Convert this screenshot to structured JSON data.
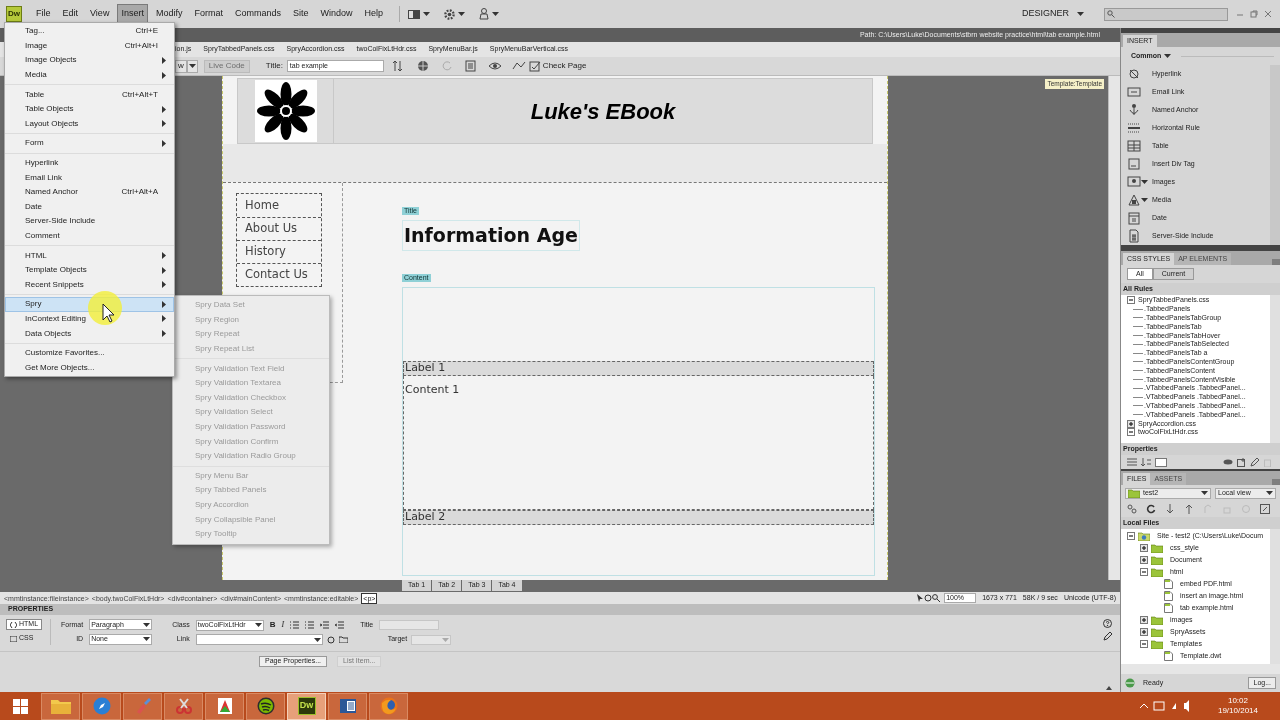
{
  "menubar": {
    "logo": "Dw",
    "menus": [
      {
        "label": "File",
        "selected": false
      },
      {
        "label": "Edit",
        "selected": false
      },
      {
        "label": "View",
        "selected": false
      },
      {
        "label": "Insert",
        "selected": true
      },
      {
        "label": "Modify",
        "selected": false
      },
      {
        "label": "Format",
        "selected": false
      },
      {
        "label": "Commands",
        "selected": false
      },
      {
        "label": "Site",
        "selected": false
      },
      {
        "label": "Window",
        "selected": false
      },
      {
        "label": "Help",
        "selected": false
      }
    ],
    "workspace": "DESIGNER"
  },
  "insert_menu": {
    "groups": [
      [
        {
          "label": "Tag...",
          "shortcut": "Ctrl+E",
          "submenu": false,
          "selected": false
        },
        {
          "label": "Image",
          "shortcut": "Ctrl+Alt+I",
          "submenu": false,
          "selected": false
        },
        {
          "label": "Image Objects",
          "submenu": true,
          "selected": false
        },
        {
          "label": "Media",
          "submenu": true,
          "selected": false
        }
      ],
      [
        {
          "label": "Table",
          "shortcut": "Ctrl+Alt+T",
          "submenu": false,
          "selected": false
        },
        {
          "label": "Table Objects",
          "submenu": true,
          "selected": false
        },
        {
          "label": "Layout Objects",
          "submenu": true,
          "selected": false
        }
      ],
      [
        {
          "label": "Form",
          "submenu": true,
          "selected": false
        }
      ],
      [
        {
          "label": "Hyperlink",
          "submenu": false,
          "selected": false
        },
        {
          "label": "Email Link",
          "submenu": false,
          "selected": false
        },
        {
          "label": "Named Anchor",
          "shortcut": "Ctrl+Alt+A",
          "submenu": false,
          "selected": false
        },
        {
          "label": "Date",
          "submenu": false,
          "selected": false
        },
        {
          "label": "Server-Side Include",
          "submenu": false,
          "selected": false
        },
        {
          "label": "Comment",
          "submenu": false,
          "selected": false
        }
      ],
      [
        {
          "label": "HTML",
          "submenu": true,
          "selected": false
        },
        {
          "label": "Template Objects",
          "submenu": true,
          "selected": false
        },
        {
          "label": "Recent Snippets",
          "submenu": true,
          "selected": false
        }
      ],
      [
        {
          "label": "Spry",
          "submenu": true,
          "selected": true
        },
        {
          "label": "InContext Editing",
          "submenu": true,
          "selected": false
        },
        {
          "label": "Data Objects",
          "submenu": true,
          "selected": false
        }
      ],
      [
        {
          "label": "Customize Favorites...",
          "submenu": false,
          "selected": false
        },
        {
          "label": "Get More Objects...",
          "submenu": false,
          "selected": false
        }
      ]
    ]
  },
  "spry_submenu": {
    "groups": [
      [
        "Spry Data Set",
        "Spry Region",
        "Spry Repeat",
        "Spry Repeat List"
      ],
      [
        "Spry Validation Text Field",
        "Spry Validation Textarea",
        "Spry Validation Checkbox",
        "Spry Validation Select",
        "Spry Validation Password",
        "Spry Validation Confirm",
        "Spry Validation Radio Group"
      ],
      [
        "Spry Menu Bar",
        "Spry Tabbed Panels",
        "Spry Accordion",
        "Spry Collapsible Panel",
        "Spry Tooltip"
      ]
    ]
  },
  "document": {
    "path": "Path:  C:\\Users\\Luke\\Documents\\stbrn website practice\\html\\tab example.html",
    "related_files": [
      "ion.js",
      "SpryTabbedPanels.css",
      "SpryAccordion.css",
      "twoColFixLtHdr.css",
      "SpryMenuBar.js",
      "SpryMenuBarVertical.css"
    ],
    "toolbar": {
      "view_fragment": "w",
      "live_code": {
        "label": "Live Code",
        "disabled": true
      },
      "title_label": "Title:",
      "title_value": "tab example",
      "check_page": "Check Page"
    }
  },
  "page": {
    "template_tag": "Template:Template",
    "site_title": "Luke's EBook",
    "nav": [
      "Home",
      "About Us",
      "History",
      "Contact Us"
    ],
    "title_tag": "Title",
    "heading": "Information Age",
    "content_tag": "Content",
    "panels": [
      {
        "label": "Label 1",
        "content": "Content 1"
      },
      {
        "label": "Label 2"
      }
    ],
    "tabs": [
      "Tab 1",
      "Tab 2",
      "Tab 3",
      "Tab 4"
    ]
  },
  "status_bar": {
    "tags": [
      {
        "label": "<mmtinstance:fileinstance>",
        "selected": false
      },
      {
        "label": "<body.twoColFixLtHdr>",
        "selected": false
      },
      {
        "label": "<div#container>",
        "selected": false
      },
      {
        "label": "<div#mainContent>",
        "selected": false
      },
      {
        "label": "<mmtinstance:editable>",
        "selected": false
      },
      {
        "label": "<p>",
        "selected": true
      }
    ],
    "zoom": "100%",
    "size": "1673 x 771",
    "download": "58K / 9 sec",
    "encoding": "Unicode (UTF-8)"
  },
  "properties": {
    "title": "PROPERTIES",
    "modes": [
      {
        "label": "HTML",
        "selected": true
      },
      {
        "label": "CSS",
        "selected": false
      }
    ],
    "format_label": "Format",
    "format_value": "Paragraph",
    "id_label": "ID",
    "id_value": "None",
    "class_label": "Class",
    "class_value": "twoColFixLtHdr",
    "link_label": "Link",
    "bold": "B",
    "italic": "I",
    "title_label": "Title",
    "target_label": "Target",
    "buttons": [
      {
        "label": "Page Properties...",
        "disabled": false
      },
      {
        "label": "List Item...",
        "disabled": true
      }
    ]
  },
  "insert_panel": {
    "title": "INSERT",
    "category": "Common",
    "items": [
      {
        "label": "Hyperlink",
        "dropdown": false
      },
      {
        "label": "Email Link",
        "dropdown": false
      },
      {
        "label": "Named Anchor",
        "dropdown": false
      },
      {
        "label": "Horizontal Rule",
        "dropdown": false
      },
      {
        "label": "Table",
        "dropdown": false
      },
      {
        "label": "Insert Div Tag",
        "dropdown": false
      },
      {
        "label": "Images",
        "dropdown": true
      },
      {
        "label": "Media",
        "dropdown": true
      },
      {
        "label": "Date",
        "dropdown": false
      },
      {
        "label": "Server-Side Include",
        "dropdown": false
      }
    ]
  },
  "css_panel": {
    "tabs": [
      {
        "label": "CSS STYLES",
        "selected": true
      },
      {
        "label": "AP ELEMENTS",
        "selected": false
      }
    ],
    "modes": [
      {
        "label": "All",
        "selected": true
      },
      {
        "label": "Current",
        "selected": false
      }
    ],
    "heading": "All Rules",
    "tree": [
      {
        "label": "SpryTabbedPanels.css",
        "expanded": true,
        "children": [
          ".TabbedPanels",
          ".TabbedPanelsTabGroup",
          ".TabbedPanelsTab",
          ".TabbedPanelsTabHover",
          ".TabbedPanelsTabSelected",
          ".TabbedPanelsTab a",
          ".TabbedPanelsContentGroup",
          ".TabbedPanelsContent",
          ".TabbedPanelsContentVisible",
          ".VTabbedPanels .TabbedPanel...",
          ".VTabbedPanels .TabbedPanel...",
          ".VTabbedPanels .TabbedPanel...",
          ".VTabbedPanels .TabbedPanel..."
        ]
      },
      {
        "label": "SpryAccordion.css",
        "expanded": false
      },
      {
        "label": "twoColFixLtHdr.css",
        "expanded": true
      }
    ],
    "properties_heading": "Properties"
  },
  "files_panel": {
    "tabs": [
      {
        "label": "FILES",
        "selected": true
      },
      {
        "label": "ASSETS",
        "selected": false
      }
    ],
    "site": "test2",
    "view": "Local view",
    "heading": "Local Files",
    "tree": [
      {
        "label": "Site - test2 (C:\\Users\\Luke\\Docum",
        "kind": "site",
        "expanded": true,
        "children": [
          {
            "label": "css_style",
            "kind": "folder",
            "expanded": false
          },
          {
            "label": "Document",
            "kind": "folder",
            "expanded": false
          },
          {
            "label": "html",
            "kind": "folder",
            "expanded": true,
            "children": [
              {
                "label": "embed PDF.html",
                "kind": "file"
              },
              {
                "label": "insert an image.html",
                "kind": "file"
              },
              {
                "label": "tab example.html",
                "kind": "file"
              }
            ]
          },
          {
            "label": "images",
            "kind": "folder",
            "expanded": false
          },
          {
            "label": "SpryAssets",
            "kind": "folder",
            "expanded": false
          },
          {
            "label": "Templates",
            "kind": "folder",
            "expanded": true,
            "children": [
              {
                "label": "Template.dwt",
                "kind": "file"
              }
            ]
          }
        ]
      }
    ],
    "status": "Ready",
    "log_button": "Log..."
  },
  "taskbar": {
    "apps": [
      {
        "kind": "explorer",
        "selected": false
      },
      {
        "kind": "compass",
        "selected": false
      },
      {
        "kind": "paint",
        "selected": false
      },
      {
        "kind": "snipping",
        "selected": false
      },
      {
        "kind": "acrobat",
        "selected": false
      },
      {
        "kind": "spotify",
        "selected": false
      },
      {
        "kind": "dreamweaver",
        "label": "Dw",
        "selected": true
      },
      {
        "kind": "word",
        "selected": false
      },
      {
        "kind": "firefox",
        "selected": false
      }
    ],
    "time": "10:02",
    "date": "19/10/2014"
  }
}
